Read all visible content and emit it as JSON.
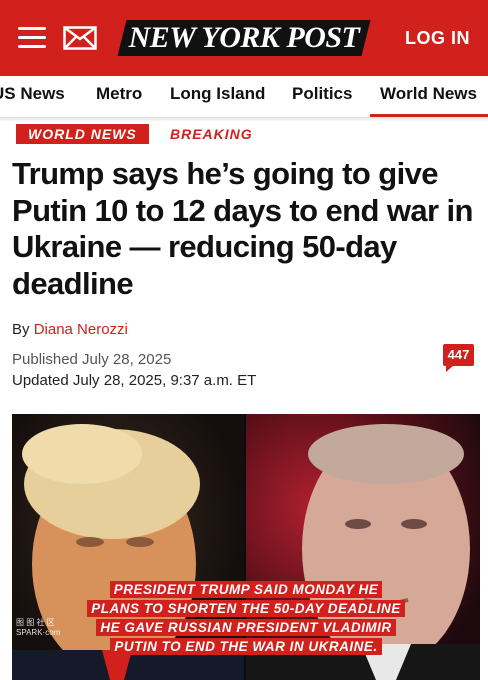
{
  "header": {
    "logo": "NEW YORK POST",
    "login": "LOG IN",
    "menu_icon": "hamburger-menu-icon",
    "mail_icon": "mail-icon",
    "brand_color": "#d2201c"
  },
  "nav": {
    "items": [
      {
        "label": "US News"
      },
      {
        "label": "Metro"
      },
      {
        "label": "Long Island"
      },
      {
        "label": "Politics"
      },
      {
        "label": "World News",
        "active": true
      }
    ]
  },
  "article": {
    "section_tag": "WORLD NEWS",
    "breaking_tag": "BREAKING",
    "headline": "Trump says he’s going to give Putin 10 to 12 days to end war in Ukraine — reducing 50-day deadline",
    "byline_prefix": "By",
    "author": "Diana Nerozzi",
    "published": "Published July 28, 2025",
    "updated": "Updated July 28, 2025, 9:37 a.m. ET",
    "comment_count": "447"
  },
  "photo": {
    "caption_lines": [
      "PRESIDENT TRUMP SAID MONDAY HE",
      "PLANS TO SHORTEN THE 50-DAY DEADLINE",
      "HE GAVE RUSSIAN PRESIDENT VLADIMIR",
      "PUTIN TO END THE WAR IN UKRAINE."
    ],
    "watermark_line1": "图 图 社 区",
    "watermark_line2": "SPARK·com"
  }
}
